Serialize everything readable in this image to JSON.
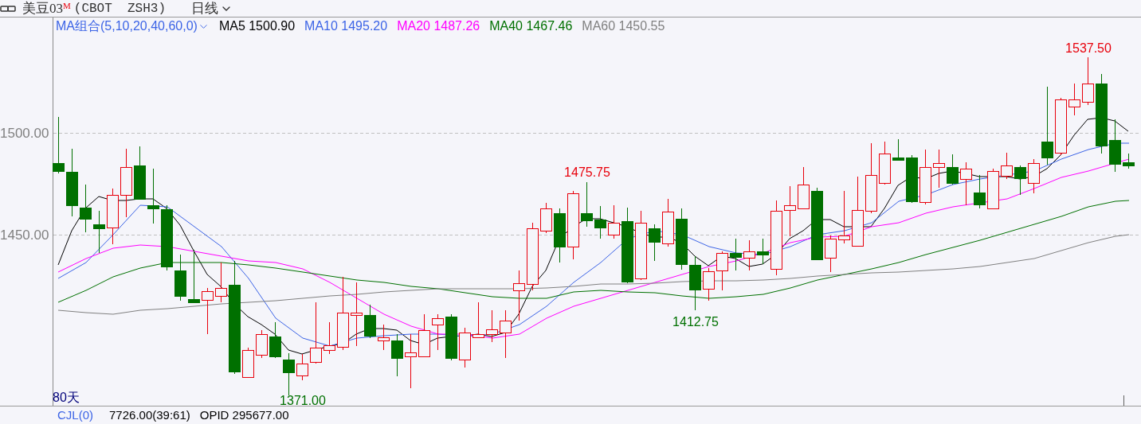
{
  "header": {
    "title": "美豆03$^{M}$",
    "code": "(CBOT  ZSH3)",
    "period": "日线"
  },
  "legend": {
    "label": "MA组合(5,10,20,40,60,0)",
    "items": [
      {
        "name": "MA5",
        "value": "1500.90",
        "color": "#000000"
      },
      {
        "name": "MA10",
        "value": "1495.20",
        "color": "#3c64e6"
      },
      {
        "name": "MA20",
        "value": "1487.26",
        "color": "#ff00ff"
      },
      {
        "name": "MA40",
        "value": "1467.46",
        "color": "#007000"
      },
      {
        "name": "MA60",
        "value": "1450.55",
        "color": "#808080"
      }
    ]
  },
  "y_axis": {
    "labels": [
      "1500.00",
      "1450.00"
    ]
  },
  "price_marks": [
    {
      "kind": "high",
      "text": "1537.50"
    },
    {
      "kind": "high",
      "text": "1475.75"
    },
    {
      "kind": "low",
      "text": "1412.75"
    },
    {
      "kind": "low",
      "text": "1371.00"
    }
  ],
  "range_label": "80天",
  "indicator_bar": {
    "name": "CJL(0)",
    "values": [
      "7726.00(39:61)",
      "OPID 295677.00"
    ]
  }
}
